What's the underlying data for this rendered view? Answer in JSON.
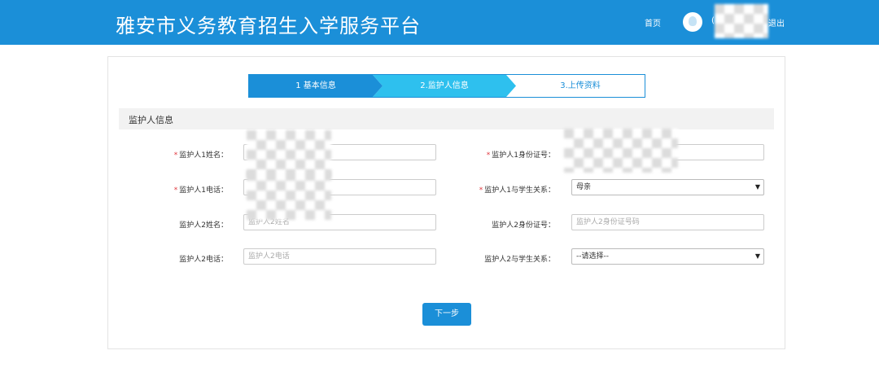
{
  "header": {
    "title": "雅安市义务教育招生入学服务平台",
    "home_label": "首页",
    "user_prefix": "(",
    "logout_label": "退出",
    "avatar_icon": "user-avatar-icon"
  },
  "steps": [
    {
      "label": "1 基本信息",
      "state": "done"
    },
    {
      "label": "2.监护人信息",
      "state": "active"
    },
    {
      "label": "3.上传资料",
      "state": "pending"
    }
  ],
  "section": {
    "title": "监护人信息"
  },
  "form": {
    "required_mark": "*",
    "g1_name_label": "监护人1姓名：",
    "g1_id_label": "监护人1身份证号：",
    "g1_phone_label": "监护人1电话：",
    "g1_relation_label": "监护人1与学生关系：",
    "g1_relation_value": "母亲",
    "g2_name_label": "监护人2姓名：",
    "g2_name_placeholder": "监护人2姓名",
    "g2_id_label": "监护人2身份证号：",
    "g2_id_placeholder": "监护人2身份证号码",
    "g2_phone_label": "监护人2电话：",
    "g2_phone_placeholder": "监护人2电话",
    "g2_relation_label": "监护人2与学生关系：",
    "g2_relation_value": "--请选择--"
  },
  "actions": {
    "next_label": "下一步"
  },
  "colors": {
    "primary": "#1b8fd8",
    "step_active": "#2ec0ee",
    "required": "#e0383e"
  }
}
